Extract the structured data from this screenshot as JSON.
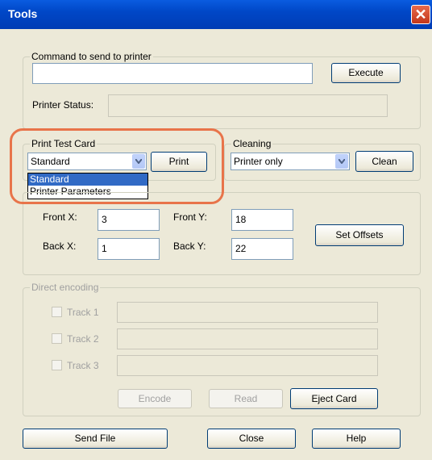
{
  "window": {
    "title": "Tools"
  },
  "command_group": {
    "legend": "Command to send to printer",
    "input_value": "",
    "execute_label": "Execute",
    "status_label": "Printer Status:",
    "status_value": ""
  },
  "test_card": {
    "legend": "Print Test Card",
    "selected": "Standard",
    "print_label": "Print",
    "options": [
      "Standard",
      "Printer Parameters"
    ]
  },
  "cleaning": {
    "legend": "Cleaning",
    "selected": "Printer only",
    "clean_label": "Clean"
  },
  "offsets": {
    "front_x_label": "Front X:",
    "front_x_value": "3",
    "front_y_label": "Front Y:",
    "front_y_value": "18",
    "back_x_label": "Back X:",
    "back_x_value": "1",
    "back_y_label": "Back Y:",
    "back_y_value": "22",
    "set_label": "Set Offsets"
  },
  "encoding": {
    "legend": "Direct encoding",
    "tracks": [
      {
        "label": "Track 1",
        "value": ""
      },
      {
        "label": "Track 2",
        "value": ""
      },
      {
        "label": "Track 3",
        "value": ""
      }
    ],
    "encode_label": "Encode",
    "read_label": "Read",
    "eject_label": "Eject Card"
  },
  "footer": {
    "send_file_label": "Send File",
    "close_label": "Close",
    "help_label": "Help"
  },
  "colors": {
    "titlebar": "#0047c7",
    "highlight": "#e8744a",
    "selection": "#316ac5"
  }
}
